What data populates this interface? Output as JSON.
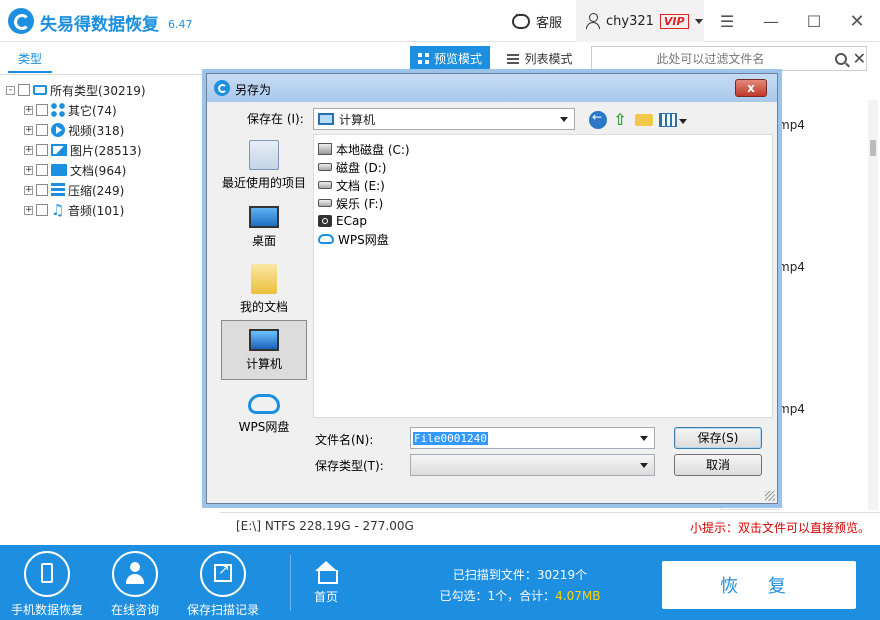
{
  "app": {
    "title": "失易得数据恢复",
    "version": "6.47"
  },
  "header": {
    "support_label": "客服",
    "username": "chy321",
    "vip_badge": "VIP"
  },
  "left_panel": {
    "tab_label": "类型",
    "tree": [
      {
        "label": "所有类型(30219)",
        "icon": "computer-icon",
        "expander": "-"
      },
      {
        "label": "其它(74)",
        "icon": "other-icon",
        "expander": "+"
      },
      {
        "label": "视频(318)",
        "icon": "video-icon",
        "expander": "+"
      },
      {
        "label": "图片(28513)",
        "icon": "image-icon",
        "expander": "+"
      },
      {
        "label": "文档(964)",
        "icon": "document-icon",
        "expander": "+"
      },
      {
        "label": "压缩(249)",
        "icon": "archive-icon",
        "expander": "+"
      },
      {
        "label": "音频(101)",
        "icon": "audio-icon",
        "expander": "+"
      }
    ]
  },
  "toolbar": {
    "preview_mode": "预览模式",
    "list_mode": "列表模式",
    "filter_placeholder": "此处可以过滤文件名"
  },
  "grid": {
    "labels": [
      "mp4",
      "mp4",
      "mp4"
    ]
  },
  "status": {
    "drive_info": "[E:\\] NTFS 228.19G - 277.00G",
    "tip": "小提示：双击文件可以直接预览。"
  },
  "bottom": {
    "mobile_recovery": "手机数据恢复",
    "online_consult": "在线咨询",
    "save_scan": "保存扫描记录",
    "home": "首页",
    "scanned_prefix": "已扫描到文件：30219个",
    "selected_prefix": "已勾选：1个，合计：",
    "selected_size": "4.07MB",
    "recover_button": "恢 复"
  },
  "dialog": {
    "title": "另存为",
    "close": "x",
    "save_in_label": "保存在 (I):",
    "save_in_value": "计算机",
    "places": [
      {
        "label": "最近使用的项目",
        "icon": "recent-items-icon"
      },
      {
        "label": "桌面",
        "icon": "desktop-icon"
      },
      {
        "label": "我的文档",
        "icon": "my-documents-icon"
      },
      {
        "label": "计算机",
        "icon": "computer-icon"
      },
      {
        "label": "WPS网盘",
        "icon": "wps-cloud-icon"
      }
    ],
    "files": [
      {
        "label": "本地磁盘 (C:)",
        "icon": "local-disk-icon"
      },
      {
        "label": "磁盘 (D:)",
        "icon": "drive-icon"
      },
      {
        "label": "文档 (E:)",
        "icon": "drive-icon"
      },
      {
        "label": "娱乐 (F:)",
        "icon": "drive-icon"
      },
      {
        "label": "ECap",
        "icon": "camera-icon"
      },
      {
        "label": "WPS网盘",
        "icon": "cloud-icon"
      }
    ],
    "filename_label": "文件名(N):",
    "filename_value": "File0001240",
    "filetype_label": "保存类型(T):",
    "filetype_value": "",
    "save_button": "保存(S)",
    "cancel_button": "取消"
  }
}
